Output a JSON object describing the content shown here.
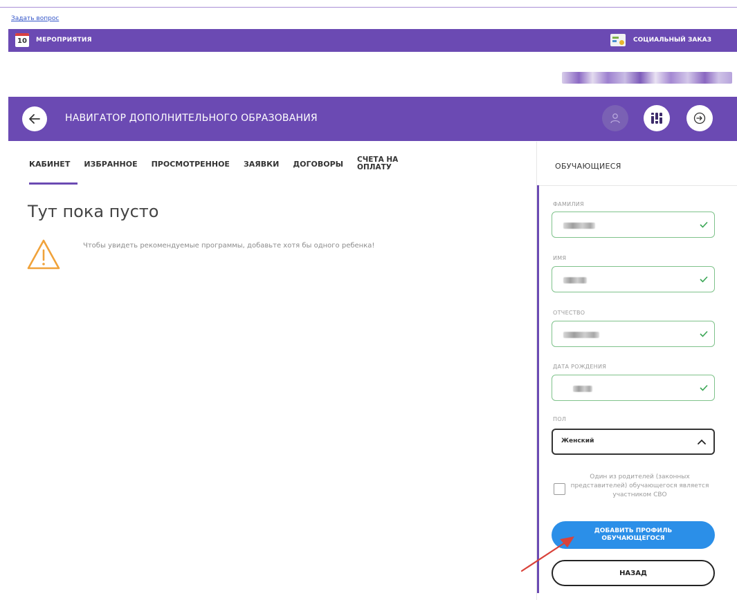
{
  "top": {
    "ask_link": "Задать вопрос"
  },
  "topbar": {
    "calendar_day": "10",
    "events_label": "МЕРОПРИЯТИЯ",
    "social_label": "СОЦИАЛЬНЫЙ ЗАКАЗ"
  },
  "navbar": {
    "title": "НАВИГАТОР ДОПОЛНИТЕЛЬНОГО ОБРАЗОВАНИЯ",
    "icons": [
      "back-arrow-icon",
      "user-icon",
      "filter-icon",
      "logout-icon"
    ]
  },
  "tabs": [
    {
      "label": "КАБИНЕТ",
      "active": true
    },
    {
      "label": "ИЗБРАННОЕ"
    },
    {
      "label": "ПРОСМОТРЕННОЕ"
    },
    {
      "label": "ЗАЯВКИ"
    },
    {
      "label": "ДОГОВОРЫ"
    },
    {
      "label": "СЧЕТА НА ОПЛАТУ"
    }
  ],
  "main": {
    "empty_title": "Тут пока пусто",
    "warning_text": "Чтобы увидеть рекомендуемые программы, добавьте хотя бы одного ребенка!"
  },
  "sidebar": {
    "header": "ОБУЧАЮЩИЕСЯ",
    "fields": [
      {
        "label": "ФАМИЛИЯ"
      },
      {
        "label": "ИМЯ"
      },
      {
        "label": "ОТЧЕСТВО"
      },
      {
        "label": "ДАТА РОЖДЕНИЯ"
      }
    ],
    "gender_label": "ПОЛ",
    "gender_value": "Женский",
    "checkbox_label": "Один из родителей (законных представителей) обучающегося является участником СВО",
    "add_button": "ДОБАВИТЬ ПРОФИЛЬ ОБУЧАЮЩЕГОСЯ",
    "back_button": "НАЗАД"
  },
  "colors": {
    "brand_purple": "#6b4ab3",
    "primary_blue": "#2b8fe8",
    "valid_green": "#7ec28a",
    "warning_orange": "#f0a23a",
    "annotation_red": "#d9423a"
  }
}
